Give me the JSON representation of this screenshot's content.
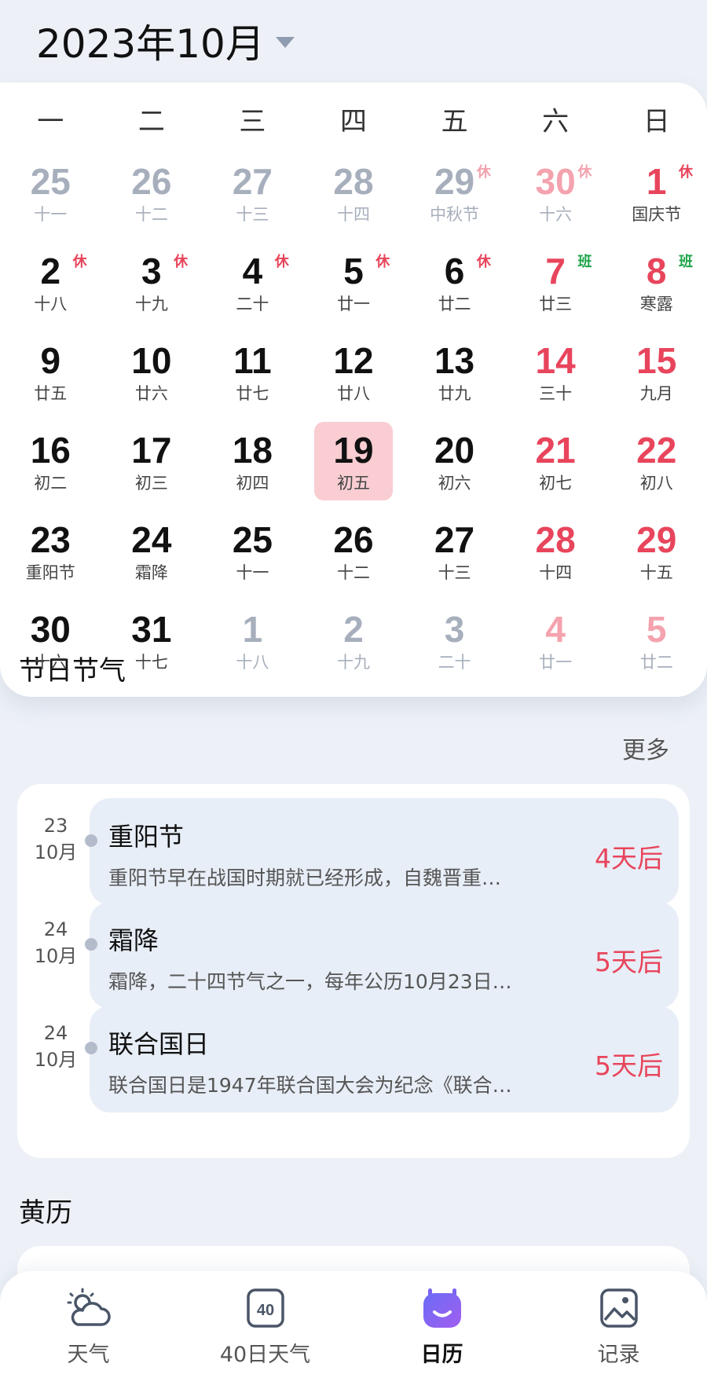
{
  "header": {
    "month_title": "2023年10月",
    "dropdown_icon": "caret-down-icon"
  },
  "weekdays": [
    "一",
    "二",
    "三",
    "四",
    "五",
    "六",
    "日"
  ],
  "calendar": [
    {
      "day": "25",
      "sub": "十一",
      "tag": "",
      "dim": true,
      "weekend": false
    },
    {
      "day": "26",
      "sub": "十二",
      "tag": "",
      "dim": true,
      "weekend": false
    },
    {
      "day": "27",
      "sub": "十三",
      "tag": "",
      "dim": true,
      "weekend": false
    },
    {
      "day": "28",
      "sub": "十四",
      "tag": "",
      "dim": true,
      "weekend": false
    },
    {
      "day": "29",
      "sub": "中秋节",
      "tag": "休",
      "tagType": "rest",
      "dim": true,
      "weekend": false
    },
    {
      "day": "30",
      "sub": "十六",
      "tag": "休",
      "tagType": "rest",
      "dim": true,
      "weekend": true
    },
    {
      "day": "1",
      "sub": "国庆节",
      "tag": "休",
      "tagType": "rest",
      "dim": false,
      "weekend": true
    },
    {
      "day": "2",
      "sub": "十八",
      "tag": "休",
      "tagType": "rest",
      "dim": false,
      "weekend": false
    },
    {
      "day": "3",
      "sub": "十九",
      "tag": "休",
      "tagType": "rest",
      "dim": false,
      "weekend": false
    },
    {
      "day": "4",
      "sub": "二十",
      "tag": "休",
      "tagType": "rest",
      "dim": false,
      "weekend": false
    },
    {
      "day": "5",
      "sub": "廿一",
      "tag": "休",
      "tagType": "rest",
      "dim": false,
      "weekend": false
    },
    {
      "day": "6",
      "sub": "廿二",
      "tag": "休",
      "tagType": "rest",
      "dim": false,
      "weekend": false
    },
    {
      "day": "7",
      "sub": "廿三",
      "tag": "班",
      "tagType": "work",
      "dim": false,
      "weekend": true
    },
    {
      "day": "8",
      "sub": "寒露",
      "tag": "班",
      "tagType": "work",
      "dim": false,
      "weekend": true
    },
    {
      "day": "9",
      "sub": "廿五",
      "tag": "",
      "dim": false,
      "weekend": false
    },
    {
      "day": "10",
      "sub": "廿六",
      "tag": "",
      "dim": false,
      "weekend": false
    },
    {
      "day": "11",
      "sub": "廿七",
      "tag": "",
      "dim": false,
      "weekend": false
    },
    {
      "day": "12",
      "sub": "廿八",
      "tag": "",
      "dim": false,
      "weekend": false
    },
    {
      "day": "13",
      "sub": "廿九",
      "tag": "",
      "dim": false,
      "weekend": false
    },
    {
      "day": "14",
      "sub": "三十",
      "tag": "",
      "dim": false,
      "weekend": true
    },
    {
      "day": "15",
      "sub": "九月",
      "tag": "",
      "dim": false,
      "weekend": true
    },
    {
      "day": "16",
      "sub": "初二",
      "tag": "",
      "dim": false,
      "weekend": false
    },
    {
      "day": "17",
      "sub": "初三",
      "tag": "",
      "dim": false,
      "weekend": false
    },
    {
      "day": "18",
      "sub": "初四",
      "tag": "",
      "dim": false,
      "weekend": false
    },
    {
      "day": "19",
      "sub": "初五",
      "tag": "",
      "dim": false,
      "weekend": false,
      "today": true
    },
    {
      "day": "20",
      "sub": "初六",
      "tag": "",
      "dim": false,
      "weekend": false
    },
    {
      "day": "21",
      "sub": "初七",
      "tag": "",
      "dim": false,
      "weekend": true
    },
    {
      "day": "22",
      "sub": "初八",
      "tag": "",
      "dim": false,
      "weekend": true
    },
    {
      "day": "23",
      "sub": "重阳节",
      "tag": "",
      "dim": false,
      "weekend": false
    },
    {
      "day": "24",
      "sub": "霜降",
      "tag": "",
      "dim": false,
      "weekend": false
    },
    {
      "day": "25",
      "sub": "十一",
      "tag": "",
      "dim": false,
      "weekend": false
    },
    {
      "day": "26",
      "sub": "十二",
      "tag": "",
      "dim": false,
      "weekend": false
    },
    {
      "day": "27",
      "sub": "十三",
      "tag": "",
      "dim": false,
      "weekend": false
    },
    {
      "day": "28",
      "sub": "十四",
      "tag": "",
      "dim": false,
      "weekend": true
    },
    {
      "day": "29",
      "sub": "十五",
      "tag": "",
      "dim": false,
      "weekend": true
    },
    {
      "day": "30",
      "sub": "十六",
      "tag": "",
      "dim": false,
      "weekend": false
    },
    {
      "day": "31",
      "sub": "十七",
      "tag": "",
      "dim": false,
      "weekend": false
    },
    {
      "day": "1",
      "sub": "十八",
      "tag": "",
      "dim": true,
      "weekend": false
    },
    {
      "day": "2",
      "sub": "十九",
      "tag": "",
      "dim": true,
      "weekend": false
    },
    {
      "day": "3",
      "sub": "二十",
      "tag": "",
      "dim": true,
      "weekend": false
    },
    {
      "day": "4",
      "sub": "廿一",
      "tag": "",
      "dim": true,
      "weekend": true
    },
    {
      "day": "5",
      "sub": "廿二",
      "tag": "",
      "dim": true,
      "weekend": true
    }
  ],
  "holidays_section": {
    "title": "节日节气",
    "more_label": "更多",
    "items": [
      {
        "day": "23",
        "month": "10月",
        "name": "重阳节",
        "desc": "重阳节早在战国时期就已经形成，自魏晋重…",
        "countdown": "4天后"
      },
      {
        "day": "24",
        "month": "10月",
        "name": "霜降",
        "desc": "霜降，二十四节气之一，每年公历10月23日…",
        "countdown": "5天后"
      },
      {
        "day": "24",
        "month": "10月",
        "name": "联合国日",
        "desc": "联合国日是1947年联合国大会为纪念《联合…",
        "countdown": "5天后"
      }
    ]
  },
  "almanac_section": {
    "title": "黄历"
  },
  "bottom_nav": [
    {
      "label": "天气",
      "icon": "weather-cloud-sun-icon",
      "active": false
    },
    {
      "label": "40日天气",
      "icon": "40-day-forecast-icon",
      "icon_text": "40",
      "active": false
    },
    {
      "label": "日历",
      "icon": "calendar-face-icon",
      "active": true
    },
    {
      "label": "记录",
      "icon": "photo-record-icon",
      "active": false
    }
  ],
  "colors": {
    "accent_red": "#e8455c",
    "work_green": "#1ea44a",
    "today_bg": "#f9cdd2",
    "nav_active": "#6b5cf5"
  }
}
